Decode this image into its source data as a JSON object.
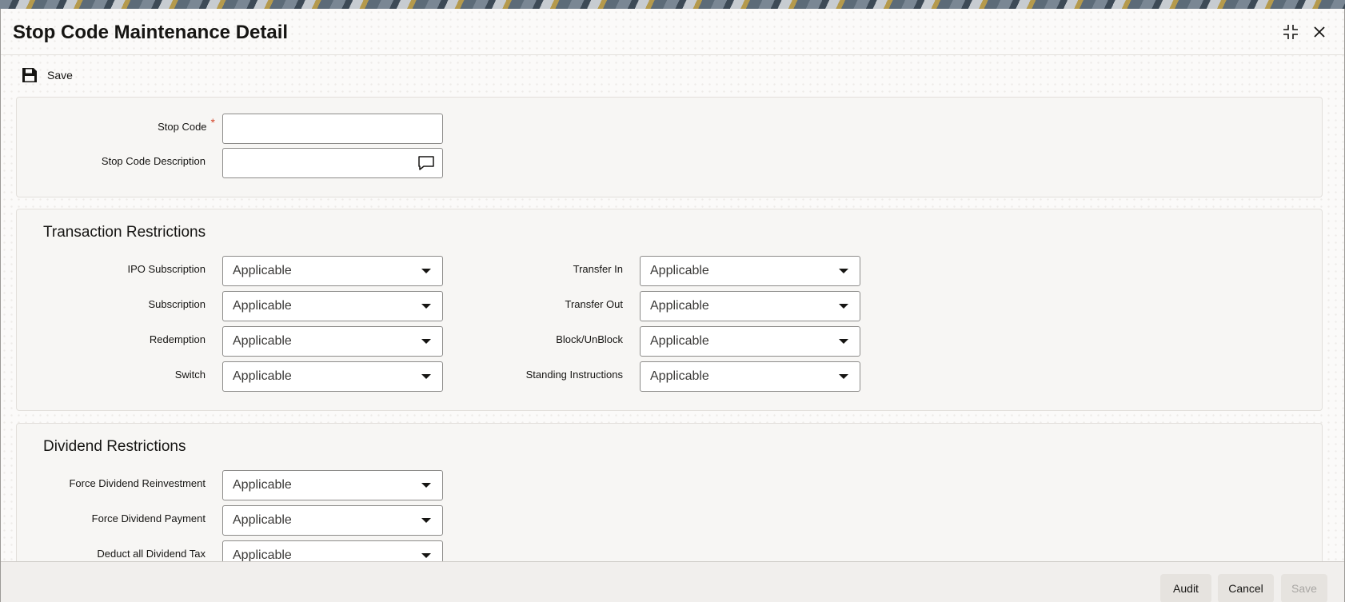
{
  "window": {
    "title": "Stop Code Maintenance Detail"
  },
  "toolbar": {
    "save_label": "Save"
  },
  "main": {
    "stop_code": {
      "label": "Stop Code",
      "required_mark": "*",
      "value": ""
    },
    "stop_code_description": {
      "label": "Stop Code Description",
      "value": ""
    }
  },
  "transaction_restrictions": {
    "title": "Transaction Restrictions",
    "left": [
      {
        "label": "IPO Subscription",
        "value": "Applicable"
      },
      {
        "label": "Subscription",
        "value": "Applicable"
      },
      {
        "label": "Redemption",
        "value": "Applicable"
      },
      {
        "label": "Switch",
        "value": "Applicable"
      }
    ],
    "right": [
      {
        "label": "Transfer In",
        "value": "Applicable"
      },
      {
        "label": "Transfer Out",
        "value": "Applicable"
      },
      {
        "label": "Block/UnBlock",
        "value": "Applicable"
      },
      {
        "label": "Standing Instructions",
        "value": "Applicable"
      }
    ]
  },
  "dividend_restrictions": {
    "title": "Dividend Restrictions",
    "fields": [
      {
        "label": "Force Dividend Reinvestment",
        "value": "Applicable"
      },
      {
        "label": "Force Dividend Payment",
        "value": "Applicable"
      },
      {
        "label": "Deduct all Dividend Tax",
        "value": "Applicable"
      }
    ]
  },
  "footer": {
    "audit_label": "Audit",
    "cancel_label": "Cancel",
    "save_label": "Save"
  },
  "icons": {
    "save": "floppy-disk-icon",
    "expand": "expand-icon",
    "close": "close-icon",
    "description": "comment-icon",
    "dropdown": "chevron-down-icon"
  }
}
